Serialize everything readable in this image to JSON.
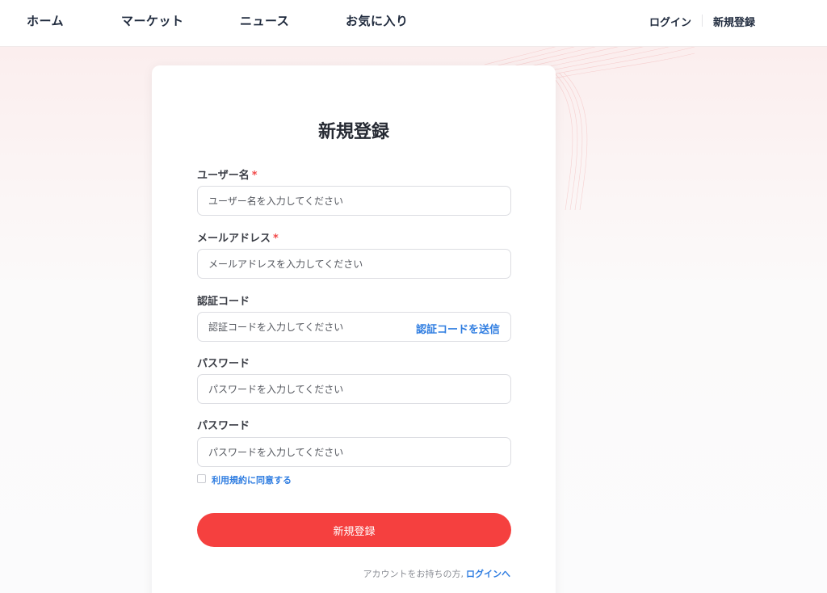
{
  "nav": {
    "items": [
      {
        "label": "ホーム"
      },
      {
        "label": "マーケット"
      },
      {
        "label": "ニュース"
      },
      {
        "label": "お気に入り"
      }
    ],
    "login_label": "ログイン",
    "register_label": "新規登録"
  },
  "form": {
    "title": "新規登録",
    "required_mark": "*",
    "fields": [
      {
        "label": "ユーザー名",
        "placeholder": "ユーザー名を入力してください",
        "value": ""
      },
      {
        "label": "メールアドレス",
        "placeholder": "メールアドレスを入力してください",
        "value": ""
      },
      {
        "label": "認証コード",
        "placeholder": "認証コードを入力してください",
        "value": "",
        "action_label": "認証コードを送信"
      },
      {
        "label": "パスワード",
        "placeholder": "パスワードを入力してください",
        "value": ""
      },
      {
        "label": "パスワード",
        "placeholder": "パスワードを入力してください",
        "value": ""
      }
    ],
    "agree_label": "利用規約に同意する",
    "agree_checked": false,
    "submit_label": "新規登録",
    "footer_text": "アカウントをお持ちの方,",
    "footer_link": "ログインへ"
  },
  "colors": {
    "accent": "#f5403f",
    "link": "#2f7de1",
    "required": "#f24a4a"
  }
}
